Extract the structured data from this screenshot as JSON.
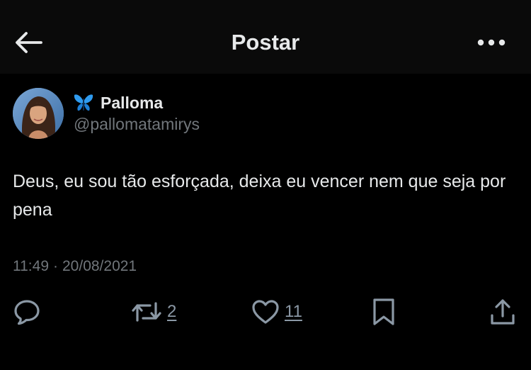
{
  "header": {
    "title": "Postar"
  },
  "author": {
    "display_name": "Palloma",
    "handle": "@pallomatamirys",
    "badge_icon": "butterfly-emoji-icon"
  },
  "tweet": {
    "text": "Deus, eu sou tão esforçada, deixa eu vencer nem que seja por pena",
    "time": "11:49",
    "separator": "·",
    "date": "20/08/2021"
  },
  "actions": {
    "reply_icon": "reply-icon",
    "repost_count": "2",
    "like_count": "11",
    "bookmark_icon": "bookmark-icon",
    "share_icon": "share-icon"
  },
  "colors": {
    "background": "#000000",
    "header_background": "#0a0a0a",
    "text_primary": "#e7e9ea",
    "text_secondary": "#71767b",
    "butterfly_blue": "#2f9bef"
  }
}
